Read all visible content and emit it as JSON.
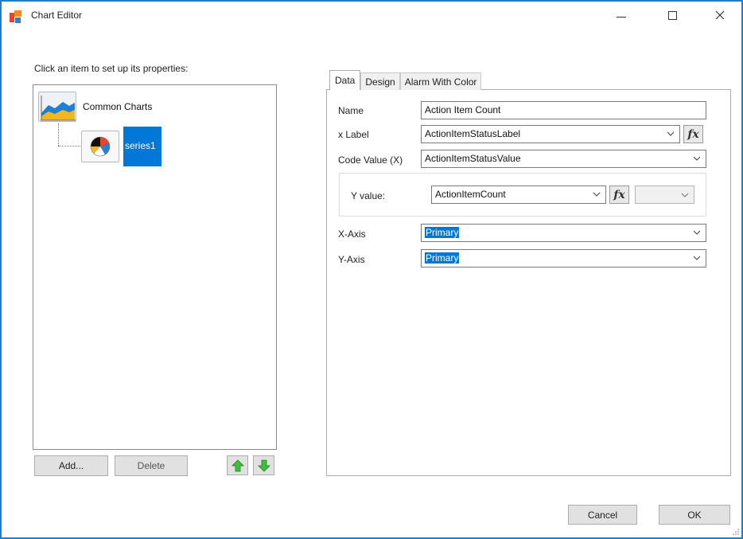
{
  "window": {
    "title": "Chart Editor",
    "accent_color": "#0078d7",
    "border_color": "#1e7fc9"
  },
  "left": {
    "prompt": "Click an item to set up  its properties:",
    "tree": {
      "root": {
        "label": "Common Charts",
        "icon": "area-chart-icon"
      },
      "child": {
        "label": "series1",
        "icon": "pie-chart-icon",
        "selected": true
      }
    },
    "buttons": {
      "add": "Add...",
      "delete": "Delete",
      "move_up_icon": "arrow-up-icon",
      "move_down_icon": "arrow-down-icon"
    }
  },
  "tabs": [
    {
      "label": "Data",
      "active": true
    },
    {
      "label": "Design",
      "active": false
    },
    {
      "label": "Alarm With Color",
      "active": false
    }
  ],
  "data_tab": {
    "name": {
      "label": "Name",
      "value": "Action Item Count"
    },
    "x_label": {
      "label": "x Label",
      "value": "ActionItemStatusLabel"
    },
    "code_value": {
      "label": "Code Value (X)",
      "value": "ActionItemStatusValue"
    },
    "y_value": {
      "label": "Y value:",
      "value": "ActionItemCount",
      "secondary_value": ""
    },
    "x_axis": {
      "label": "X-Axis",
      "value": "Primary"
    },
    "y_axis": {
      "label": "Y-Axis",
      "value": "Primary"
    },
    "fx_label": "fx"
  },
  "footer": {
    "cancel": "Cancel",
    "ok": "OK"
  }
}
